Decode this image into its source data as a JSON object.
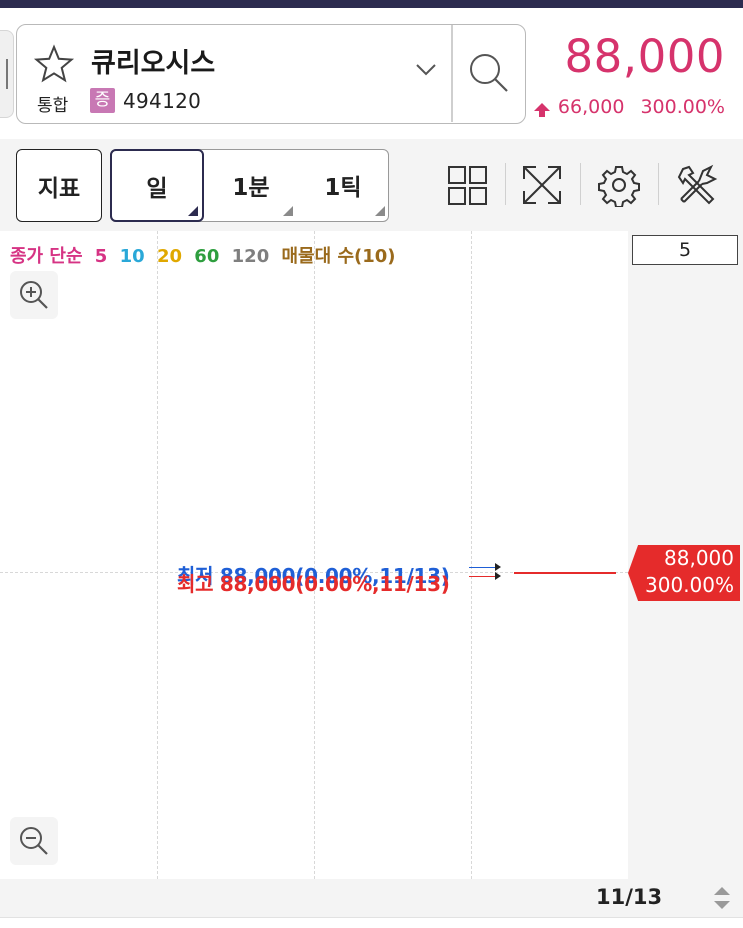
{
  "header": {
    "stock_name": "큐리오시스",
    "market": "통합",
    "type_badge": "증",
    "code": "494120",
    "price": "88,000",
    "change": "66,000",
    "change_pct": "300.00%"
  },
  "toolbar": {
    "indicator_label": "지표",
    "periods": [
      {
        "label": "일",
        "active": true
      },
      {
        "label": "1분",
        "active": false
      },
      {
        "label": "1틱",
        "active": false
      }
    ],
    "icons": [
      "grid-layout-icon",
      "expand-icon",
      "settings-gear-icon",
      "tools-icon"
    ]
  },
  "chart": {
    "legend": [
      {
        "text": "종가 단순",
        "color": "#d63384"
      },
      {
        "text": "5",
        "color": "#d63384"
      },
      {
        "text": "10",
        "color": "#2aa8d8"
      },
      {
        "text": "20",
        "color": "#e0a800"
      },
      {
        "text": "60",
        "color": "#2e9e3e"
      },
      {
        "text": "120",
        "color": "#7f7f7f"
      },
      {
        "text": "매물대 수(10)",
        "color": "#9a6a1c"
      }
    ],
    "input_value": "5",
    "low_annotation": "최저 88,000(0.00%,11/13)",
    "high_annotation": "최고 88,000(0.00%,11/13)",
    "price_tag_value": "88,000",
    "price_tag_pct": "300.00%",
    "colors": {
      "low": "#1f5fd6",
      "high": "#e52b2b",
      "accent": "#d6336c"
    }
  },
  "bottom": {
    "date": "11/13"
  }
}
